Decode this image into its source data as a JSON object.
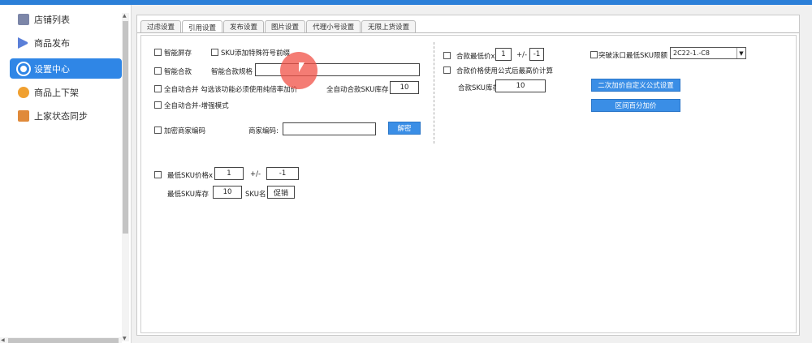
{
  "sidebar": {
    "items": [
      {
        "label": "店铺列表",
        "icon": "store-icon",
        "active": false
      },
      {
        "label": "商品发布",
        "icon": "send-icon",
        "active": false
      },
      {
        "label": "设置中心",
        "icon": "gear-icon",
        "active": true
      },
      {
        "label": "商品上下架",
        "icon": "shelf-icon",
        "active": false
      },
      {
        "label": "上家状态同步",
        "icon": "sync-icon",
        "active": false
      }
    ]
  },
  "tabs": [
    {
      "label": "过虑设置",
      "active": false
    },
    {
      "label": "引用设置",
      "active": true
    },
    {
      "label": "发布设置",
      "active": false
    },
    {
      "label": "图片设置",
      "active": false
    },
    {
      "label": "代理小号设置",
      "active": false
    },
    {
      "label": "无限上货设置",
      "active": false
    }
  ],
  "left": {
    "smart_split": "智能屏存",
    "sku_special": "SKU添加特殊符号前缀",
    "smart_merge": "智能合款",
    "smart_merge_label": "智能合款规格",
    "smart_merge_value": "",
    "auto_merge": "全自动合并  勾选该功能必须使用纯倍率加价",
    "auto_merge_stock_label": "全自动合款SKU库存",
    "auto_merge_stock_value": "10",
    "auto_merge_enhanced": "全自动合并-增强模式",
    "encrypt_code": "加密商家编码",
    "merchant_code_label": "商家编码:",
    "merchant_code_value": "",
    "decrypt_button": "解密",
    "lowest_sku_price": "最低SKU价格x",
    "lowest_price_mult": "1",
    "plus_minus": "+/-",
    "lowest_price_offset": "-1",
    "lowest_sku_stock_label": "最低SKU库存",
    "lowest_sku_stock_value": "10",
    "sku_name_label": "SKU名",
    "promo_button": "促销"
  },
  "right": {
    "merge_max_price": "合款最低价x",
    "merge_max_mult": "1",
    "plus_minus": "+/-",
    "merge_max_offset": "-1",
    "merge_price_formula": "合款价格使用公式后最高价计算",
    "merge_sku_stock_label": "合款SKU库存",
    "merge_sku_stock_value": "10",
    "breakthrough": "突破泳口最低SKU限额",
    "breakthrough_value": "2C22-1.-C8",
    "secondary_formula_button": "二次加价自定义公式设置",
    "range_markup_button": "区间百分加价"
  }
}
